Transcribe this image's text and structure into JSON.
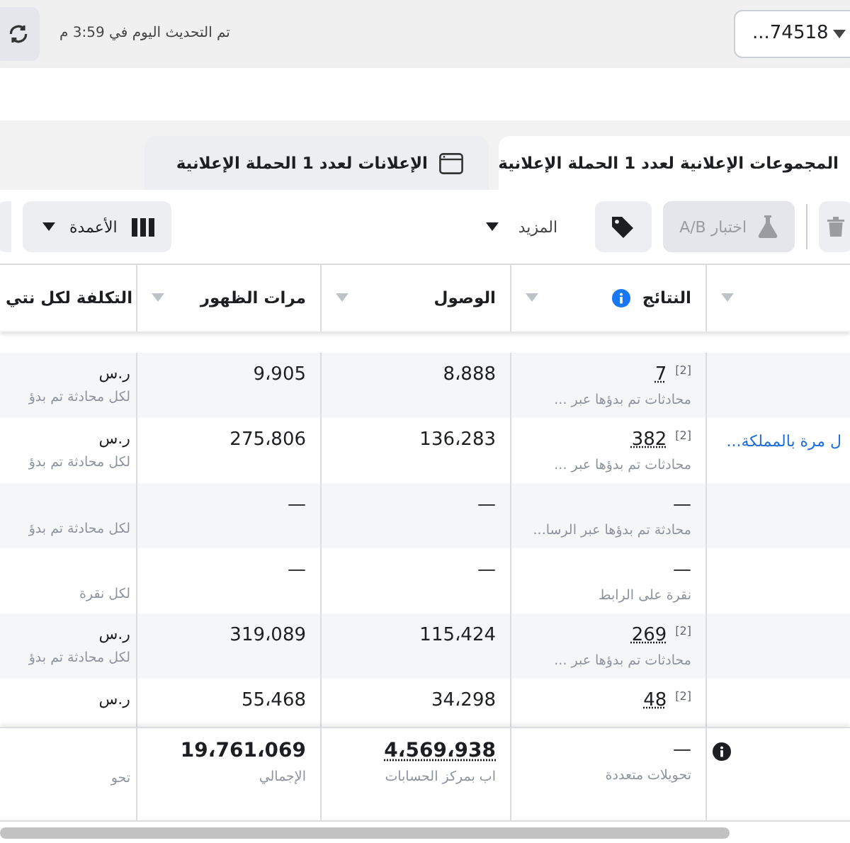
{
  "top_bar": {
    "status": "تم التحديث اليوم في 3:59 م",
    "account": "...74518"
  },
  "tabs": [
    {
      "label": "المجموعات الإعلانية لعدد **1** الحملة الإعلانية",
      "selected": true
    },
    {
      "label": "الإعلانات لعدد **1** الحملة الإعلانية",
      "selected": false
    }
  ],
  "toolbar": {
    "ab_test": {
      "label": "اختبار A/B",
      "disabled": true
    },
    "more": "المزيد",
    "columns": "الأعمدة"
  },
  "table": {
    "columns": [
      {
        "label": "النتائج",
        "info": true
      },
      {
        "label": "الوصول"
      },
      {
        "label": "مرات الظهور"
      },
      {
        "label": "التكلفة لكل نتي"
      }
    ],
    "rows": [
      {
        "results": {
          "value": "7",
          "note": "[2]",
          "sub": "محادثات تم بدؤها عبر ..."
        },
        "reach": "8،888",
        "impressions": "9،905",
        "cost": {
          "value": "ر.س",
          "sub": "لكل محادثة تم بدؤ"
        }
      },
      {
        "name": "ل مرة بالمملكة...",
        "results": {
          "value": "382",
          "note": "[2]",
          "sub": "محادثات تم بدؤها عبر ..."
        },
        "reach": "136،283",
        "impressions": "275،806",
        "cost": {
          "value": "ر.س",
          "sub": "لكل محادثة تم بدؤ"
        }
      },
      {
        "results": {
          "value": "—",
          "sub": "محادثة تم بدؤها عبر الرسا..."
        },
        "reach": "—",
        "impressions": "—",
        "cost": {
          "sub": "لكل محادثة تم بدؤ"
        }
      },
      {
        "results": {
          "value": "—",
          "sub": "نقرة على الرابط"
        },
        "reach": "—",
        "impressions": "—",
        "cost": {
          "sub": "لكل نقرة"
        }
      },
      {
        "results": {
          "value": "269",
          "note": "[2]",
          "sub": "محادثات تم بدؤها عبر ..."
        },
        "reach": "115،424",
        "impressions": "319،089",
        "cost": {
          "value": "ر.س",
          "sub": "لكل محادثة تم بدؤ"
        }
      },
      {
        "results": {
          "value": "48",
          "note": "[2]"
        },
        "reach": "34،298",
        "impressions": "55،468",
        "cost": {
          "value": "ر.س"
        }
      }
    ],
    "totals": {
      "results": {
        "value": "—",
        "sub": "تحويلات متعددة"
      },
      "reach": {
        "value": "4،569،938",
        "sub": "اب بمركز الحسابات"
      },
      "impressions": {
        "value": "19،761،069",
        "sub": "الإجمالي"
      },
      "cost": {
        "sub": "تحو"
      }
    }
  }
}
